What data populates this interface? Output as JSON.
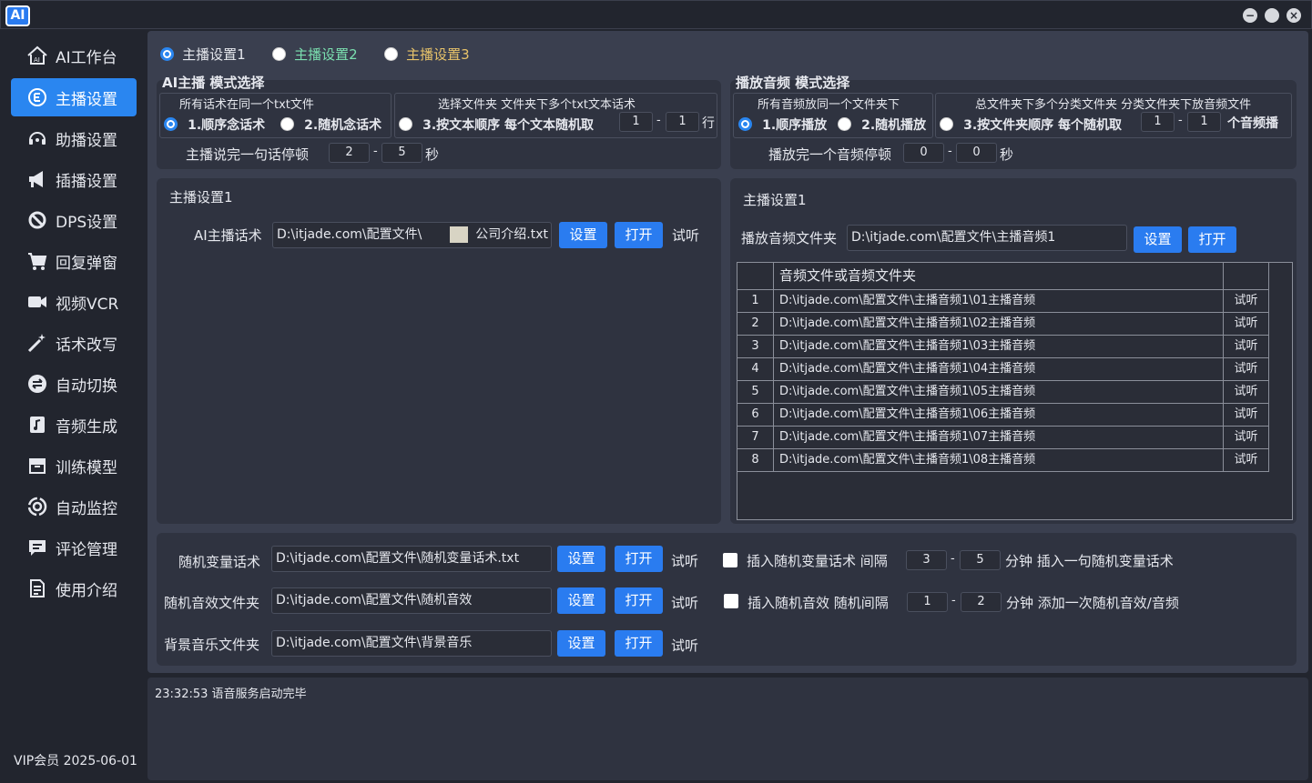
{
  "app": {
    "logo": "AI",
    "min": "−",
    "max": "",
    "close": "×"
  },
  "sidebar": {
    "items": [
      {
        "label": "AI工作台",
        "icon": "home-icon"
      },
      {
        "label": "主播设置",
        "icon": "anchor-icon"
      },
      {
        "label": "助播设置",
        "icon": "headset-icon"
      },
      {
        "label": "插播设置",
        "icon": "megaphone-icon"
      },
      {
        "label": "DPS设置",
        "icon": "ban-icon"
      },
      {
        "label": "回复弹窗",
        "icon": "cart-icon"
      },
      {
        "label": "视频VCR",
        "icon": "video-camera-icon"
      },
      {
        "label": "话术改写",
        "icon": "magic-wand-icon"
      },
      {
        "label": "自动切换",
        "icon": "switch-icon"
      },
      {
        "label": "音频生成",
        "icon": "music-file-icon"
      },
      {
        "label": "训练模型",
        "icon": "box-icon"
      },
      {
        "label": "自动监控",
        "icon": "monitor-icon"
      },
      {
        "label": "评论管理",
        "icon": "comment-icon"
      },
      {
        "label": "使用介绍",
        "icon": "document-icon"
      }
    ],
    "active_index": 1,
    "vip": "VIP会员  2025-06-01"
  },
  "tabs": [
    "主播设置1",
    "主播设置2",
    "主播设置3"
  ],
  "ai_mode": {
    "title": "AI主播 模式选择",
    "group1_caption": "所有话术在同一个txt文件",
    "opt1": "1.顺序念话术",
    "opt2": "2.随机念话术",
    "group2_caption": "选择文件夹  文件夹下多个txt文本话术",
    "opt3": "3.按文本顺序 每个文本随机取",
    "range_from": "1",
    "range_to": "1",
    "unit": "行",
    "pause_label": "主播说完一句话停顿",
    "pause_from": "2",
    "pause_to": "5",
    "pause_unit": "秒",
    "dash": "-"
  },
  "audio_mode": {
    "title": "播放音频 模式选择",
    "group1_caption": "所有音频放同一个文件夹下",
    "opt1": "1.顺序播放",
    "opt2": "2.随机播放",
    "group2_caption": "总文件夹下多个分类文件夹 分类文件夹下放音频文件",
    "opt3": "3.按文件夹顺序 每个随机取",
    "range_from": "1",
    "range_to": "1",
    "unit": "个音频播",
    "pause_label": "播放完一个音频停顿",
    "pause_from": "0",
    "pause_to": "0",
    "pause_unit": "秒"
  },
  "left_card": {
    "title": "主播设置1",
    "script_label": "AI主播话术",
    "script_path_a": "D:\\itjade.com\\配置文件\\",
    "script_path_b": "公司介绍.txt",
    "set": "设置",
    "open": "打开",
    "listen": "试听"
  },
  "right_card": {
    "title": "主播设置1",
    "folder_label": "播放音频文件夹",
    "folder_path": "D:\\itjade.com\\配置文件\\主播音频1",
    "set": "设置",
    "open": "打开",
    "table_header": "音频文件或音频文件夹",
    "rows": [
      {
        "n": "1",
        "path": "D:\\itjade.com\\配置文件\\主播音频1\\01主播音频",
        "action": "试听"
      },
      {
        "n": "2",
        "path": "D:\\itjade.com\\配置文件\\主播音频1\\02主播音频",
        "action": "试听"
      },
      {
        "n": "3",
        "path": "D:\\itjade.com\\配置文件\\主播音频1\\03主播音频",
        "action": "试听"
      },
      {
        "n": "4",
        "path": "D:\\itjade.com\\配置文件\\主播音频1\\04主播音频",
        "action": "试听"
      },
      {
        "n": "5",
        "path": "D:\\itjade.com\\配置文件\\主播音频1\\05主播音频",
        "action": "试听"
      },
      {
        "n": "6",
        "path": "D:\\itjade.com\\配置文件\\主播音频1\\06主播音频",
        "action": "试听"
      },
      {
        "n": "7",
        "path": "D:\\itjade.com\\配置文件\\主播音频1\\07主播音频",
        "action": "试听"
      },
      {
        "n": "8",
        "path": "D:\\itjade.com\\配置文件\\主播音频1\\08主播音频",
        "action": "试听"
      }
    ]
  },
  "bottom": {
    "rows": [
      {
        "label": "随机变量话术",
        "path": "D:\\itjade.com\\配置文件\\随机变量话术.txt",
        "set": "设置",
        "open": "打开",
        "listen": "试听",
        "check_label": "插入随机变量话术 间隔",
        "from": "3",
        "to": "5",
        "suffix": "分钟 插入一句随机变量话术"
      },
      {
        "label": "随机音效文件夹",
        "path": "D:\\itjade.com\\配置文件\\随机音效",
        "set": "设置",
        "open": "打开",
        "listen": "试听",
        "check_label": "插入随机音效 随机间隔",
        "from": "1",
        "to": "2",
        "suffix": "分钟 添加一次随机音效/音频"
      },
      {
        "label": "背景音乐文件夹",
        "path": "D:\\itjade.com\\配置文件\\背景音乐",
        "set": "设置",
        "open": "打开",
        "listen": "试听"
      }
    ]
  },
  "log": {
    "line": "23:32:53 语音服务启动完毕"
  }
}
